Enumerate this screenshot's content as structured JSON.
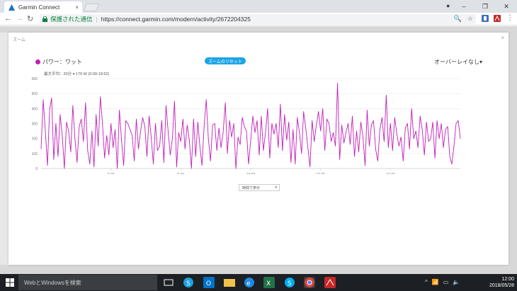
{
  "browser": {
    "tab_title": "Garmin Connect",
    "tab_close": "×",
    "window_controls": [
      "–",
      "❐",
      "✕"
    ],
    "secure_label": "保護された通信",
    "url": "https://connect.garmin.com/modern/activity/2672204325",
    "nav": {
      "back": "←",
      "forward": "→",
      "reload": "↻"
    },
    "omni_icons": [
      "🔍",
      "☆"
    ]
  },
  "modal": {
    "title": "ズーム",
    "close": "×",
    "metric_label": "パワー：ワット",
    "reset_button": "ズームのリセット",
    "overlay_label": "オーバーレイなし▾",
    "max_avg": "最大平均：20分 ▾  179 W (0:09-19:52)",
    "select_label": "時間で表示",
    "select_arrow": "▾"
  },
  "colors": {
    "series": "#c21fb9",
    "accent": "#1ea4e6"
  },
  "chart_data": {
    "type": "line",
    "ylabel": "",
    "ylim": [
      0,
      600
    ],
    "yticks": [
      "0",
      "100",
      "200",
      "300",
      "400",
      "500",
      "600"
    ],
    "xticks": [
      "3:20",
      "6:40",
      "10:00",
      "13:20",
      "16:40"
    ],
    "x_minutes_range": [
      0,
      20
    ],
    "series": [
      {
        "values": [
          130,
          460,
          250,
          20,
          390,
          470,
          60,
          300,
          80,
          360,
          220,
          0,
          310,
          250,
          110,
          420,
          200,
          40,
          280,
          330,
          180,
          440,
          120,
          30,
          250,
          10,
          360,
          150,
          480,
          300,
          70,
          220,
          90,
          300,
          140,
          260,
          0,
          390,
          190,
          20,
          320,
          300,
          260,
          220,
          50,
          330,
          130,
          250,
          340,
          280,
          80,
          350,
          210,
          30,
          300,
          120,
          150,
          320,
          40,
          420,
          250,
          90,
          200,
          450,
          10,
          240,
          180,
          330,
          130,
          290,
          190,
          0,
          330,
          80,
          310,
          150,
          20,
          280,
          460,
          200,
          50,
          290,
          300,
          120,
          270,
          140,
          240,
          440,
          100,
          320,
          210,
          300,
          0,
          210,
          160,
          340,
          280,
          250,
          30,
          190,
          350,
          240,
          320,
          90,
          350,
          120,
          240,
          400,
          70,
          300,
          230,
          300,
          140,
          430,
          120,
          360,
          190,
          310,
          40,
          260,
          30,
          340,
          240,
          100,
          380,
          270,
          140,
          10,
          320,
          180,
          290,
          380,
          250,
          400,
          120,
          330,
          300,
          180,
          240,
          150,
          570,
          60,
          290,
          170,
          240,
          300,
          160,
          350,
          80,
          250,
          110,
          310,
          210,
          20,
          390,
          150,
          290,
          320,
          130,
          50,
          260,
          340,
          180,
          490,
          140,
          300,
          120,
          340,
          230,
          150,
          210,
          50,
          270,
          300,
          130,
          400,
          200,
          250,
          140,
          350,
          260,
          90,
          310,
          180,
          200,
          310,
          70,
          320,
          200,
          300,
          140,
          260,
          280,
          80,
          30,
          150,
          300,
          320,
          200
        ]
      }
    ]
  },
  "taskbar": {
    "search_placeholder": "WebとWindowsを検索",
    "time": "12:00",
    "date": "2018/05/28"
  }
}
